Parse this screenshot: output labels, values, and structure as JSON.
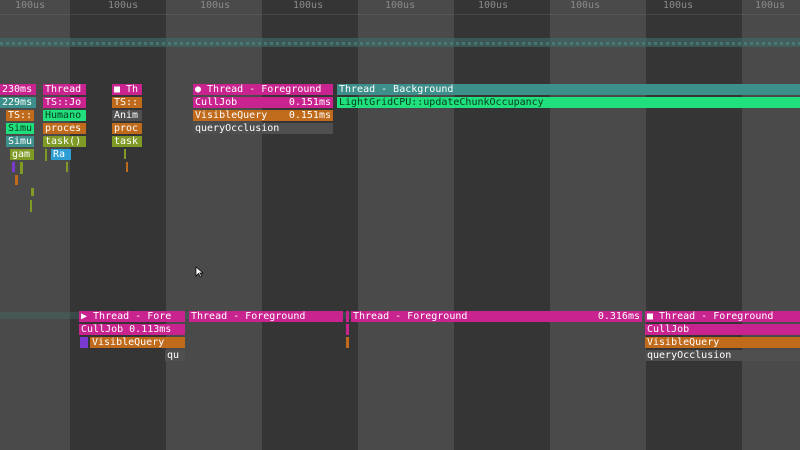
{
  "ruler": {
    "tick_label": "100us",
    "tick_count": 9
  },
  "colors": {
    "magenta": "#c8238f",
    "orange": "#c06a1c",
    "teal": "#3c8f8a",
    "green": "#1fe07c",
    "olive": "#7f9a25",
    "cyan": "#2d9fd4",
    "gray": "#4f4f4f"
  },
  "upper": {
    "col_a": {
      "d1": "230ms",
      "d2": "229ms",
      "ts": "TS::",
      "simu1": "Simu",
      "simu2": "Simu",
      "gam": "gam"
    },
    "col_b": {
      "thread": "Thread",
      "tsjo": "TS::Jo",
      "humano": "Humano",
      "proces": "proces",
      "task": "task()",
      "ra": "Ra"
    },
    "col_c": {
      "thread": "■ Th",
      "ts": "TS::",
      "anim": "Anim",
      "proc": "proc",
      "task": "task"
    },
    "fg": {
      "thread": "● Thread - Foreground",
      "culljob": "CullJob",
      "culljob_dur": "0.151ms",
      "visiblequery": "VisibleQuery",
      "visiblequery_dur": "0.151ms",
      "queryocclusion": "queryOcclusion"
    },
    "bg": {
      "thread": "Thread - Background",
      "lightgrid": "LightGridCPU::updateChunkOccupancy"
    }
  },
  "lower": {
    "fg1": {
      "thread": "▶ Thread - Fore",
      "culljob": "CullJob 0.113ms",
      "visiblequery": "VisibleQuery",
      "qu": "qu"
    },
    "fg2": {
      "thread": "Thread - Foreground"
    },
    "fg3": {
      "thread": "Thread - Foreground",
      "dur": "0.316ms"
    },
    "fg4": {
      "thread": "■ Thread - Foreground",
      "culljob": "CullJob",
      "visiblequery": "VisibleQuery",
      "queryocclusion": "queryOcclusion"
    }
  }
}
